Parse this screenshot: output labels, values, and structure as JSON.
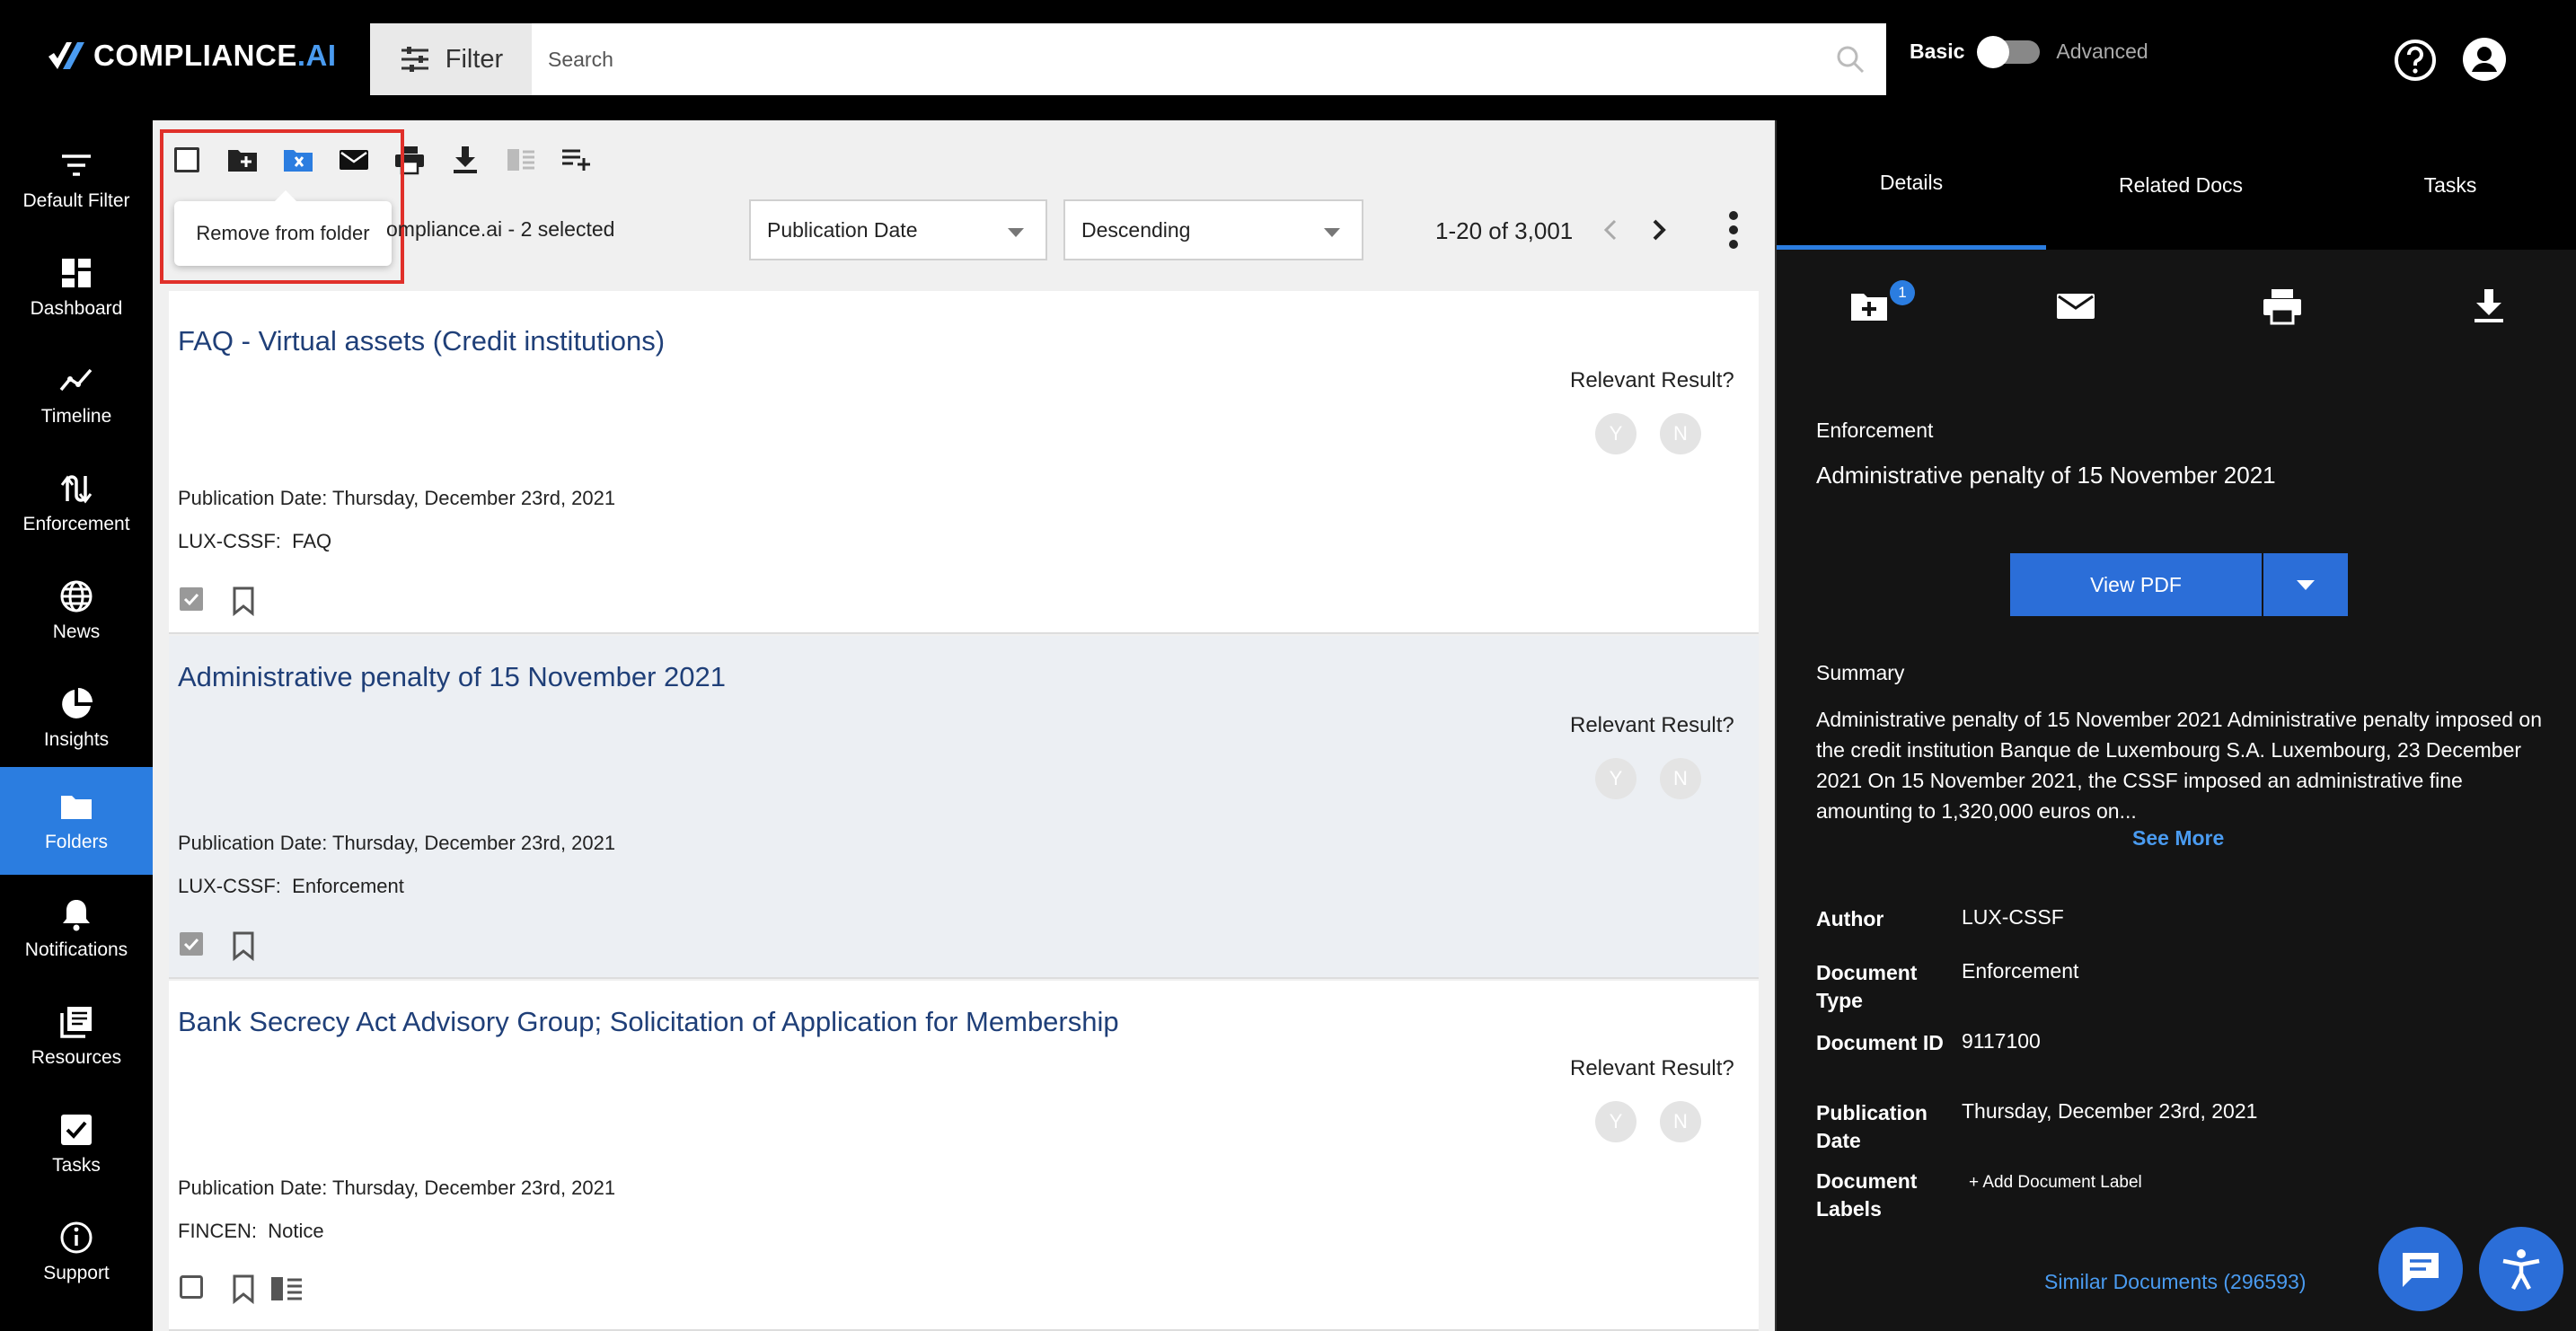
{
  "header": {
    "logo_main": "COMPLIANCE",
    "logo_ai": ".AI",
    "filter_label": "Filter",
    "search_placeholder": "Search",
    "mode_basic": "Basic",
    "mode_advanced": "Advanced"
  },
  "sidebar": {
    "items": [
      {
        "label": "Default Filter",
        "icon": "filter-lines-icon"
      },
      {
        "label": "Dashboard",
        "icon": "dashboard-icon"
      },
      {
        "label": "Timeline",
        "icon": "timeline-icon"
      },
      {
        "label": "Enforcement",
        "icon": "enforcement-icon"
      },
      {
        "label": "News",
        "icon": "globe-icon"
      },
      {
        "label": "Insights",
        "icon": "pie-chart-icon"
      },
      {
        "label": "Folders",
        "icon": "folder-icon",
        "active": true
      },
      {
        "label": "Notifications",
        "icon": "bell-icon"
      },
      {
        "label": "Resources",
        "icon": "library-icon"
      },
      {
        "label": "Tasks",
        "icon": "checkbox-icon"
      },
      {
        "label": "Support",
        "icon": "info-icon"
      }
    ]
  },
  "toolbar": {
    "tooltip": "Remove from folder",
    "selection_text": "ompliance.ai - 2 selected",
    "sort_field": "Publication Date",
    "sort_order": "Descending",
    "pagination": "1-20 of 3,001"
  },
  "results": [
    {
      "title": "FAQ - Virtual assets (Credit institutions)",
      "relevant_label": "Relevant Result?",
      "yes": "Y",
      "no": "N",
      "pub_date": "Publication Date: Thursday, December 23rd, 2021",
      "agency": "LUX-CSSF:",
      "doc_type": "FAQ",
      "checked": true
    },
    {
      "title": "Administrative penalty of 15 November 2021",
      "relevant_label": "Relevant Result?",
      "yes": "Y",
      "no": "N",
      "pub_date": "Publication Date: Thursday, December 23rd, 2021",
      "agency": "LUX-CSSF:",
      "doc_type": "Enforcement",
      "checked": true
    },
    {
      "title": "Bank Secrecy Act Advisory Group; Solicitation of Application for Membership",
      "relevant_label": "Relevant Result?",
      "yes": "Y",
      "no": "N",
      "pub_date": "Publication Date: Thursday, December 23rd, 2021",
      "agency": "FINCEN:",
      "doc_type": "Notice",
      "checked": false
    }
  ],
  "details": {
    "tabs": [
      "Details",
      "Related Docs",
      "Tasks"
    ],
    "folder_badge": "1",
    "category": "Enforcement",
    "doc_title": "Administrative penalty of 15 November 2021",
    "view_pdf": "View PDF",
    "summary_heading": "Summary",
    "summary": "Administrative penalty of 15 November 2021 Administrative penalty imposed on the credit institution Banque de Luxembourg S.A. Luxembourg, 23 December 2021 On 15 November 2021, the CSSF imposed an administrative fine amounting to 1,320,000 euros on...",
    "see_more": "See More",
    "meta": [
      {
        "label": "Author",
        "value": "LUX-CSSF"
      },
      {
        "label": "Document Type",
        "value": "Enforcement"
      },
      {
        "label": "Document ID",
        "value": "9117100"
      },
      {
        "label": "Publication Date",
        "value": "Thursday, December 23rd, 2021"
      },
      {
        "label": "Document Labels",
        "value": ""
      }
    ],
    "add_label": "+ Add Document Label",
    "similar": "Similar Documents (296593)"
  },
  "colors": {
    "accent": "#2b7de0",
    "title_link": "#1f3f78",
    "highlight": "#e0302a"
  }
}
